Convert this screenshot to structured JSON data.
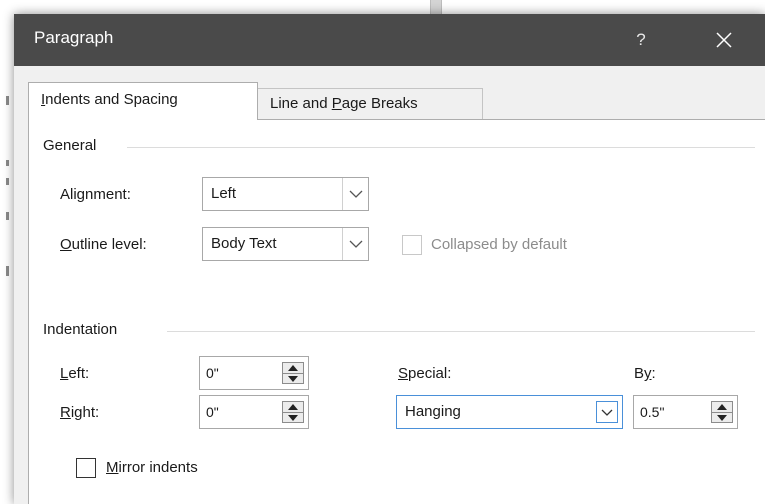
{
  "dialog": {
    "title": "Paragraph",
    "help_label": "?"
  },
  "tabs": [
    {
      "label_pre": "",
      "accel": "I",
      "label_post": "ndents and Spacing",
      "active": true
    },
    {
      "label_pre": "Line and ",
      "accel": "P",
      "label_post": "age Breaks",
      "active": false
    }
  ],
  "general": {
    "group_label": "General",
    "alignment": {
      "label_pre": "Ali",
      "accel": "g",
      "label_post": "nment:",
      "value": "Left"
    },
    "outline_level": {
      "label_pre": "",
      "accel": "O",
      "label_post": "utline level:",
      "value": "Body Text"
    },
    "collapsed": {
      "label": "Collapsed by default",
      "checked": false,
      "enabled": false
    }
  },
  "indentation": {
    "group_label": "Indentation",
    "left": {
      "accel": "L",
      "label_post": "eft:",
      "value": "0\""
    },
    "right": {
      "accel": "R",
      "label_post": "ight:",
      "value": "0\""
    },
    "special": {
      "accel": "S",
      "label_post": "pecial:",
      "value": "Hanging"
    },
    "by": {
      "label_pre": "B",
      "accel": "y",
      "label_post": ":",
      "value": "0.5\""
    },
    "mirror": {
      "accel": "M",
      "label_post": "irror indents",
      "checked": false
    }
  },
  "colors": {
    "titlebar": "#4a4a4a",
    "focus": "#4a90d9"
  }
}
